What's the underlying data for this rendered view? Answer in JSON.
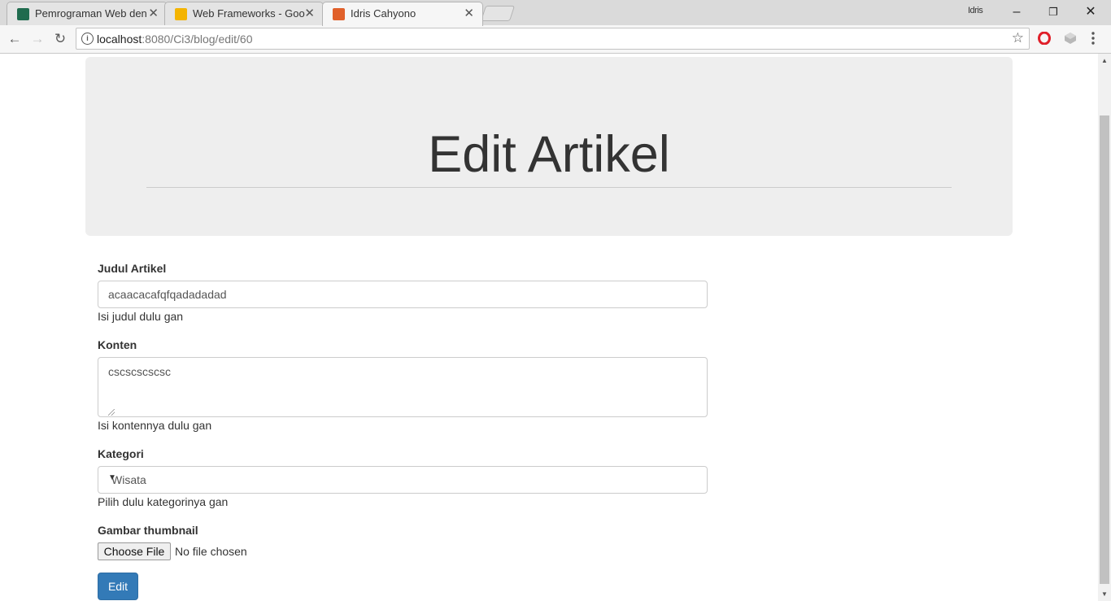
{
  "browser": {
    "tabs": [
      {
        "title": "Pemrograman Web deng",
        "favicon_color": "#1f6b4e",
        "close": "✕"
      },
      {
        "title": "Web Frameworks - Goog",
        "favicon_color": "#f4b400",
        "close": "✕"
      },
      {
        "title": "Idris Cahyono",
        "favicon_color": "#e0602a",
        "close": "✕"
      }
    ],
    "profile_name": "Idris",
    "window_controls": {
      "minimize": "–",
      "restore": "❐",
      "close": "✕"
    },
    "url_host": "localhost",
    "url_path": ":8080/Ci3/blog/edit/60",
    "nav": {
      "back": "←",
      "forward": "→",
      "reload": "↻"
    },
    "star": "☆"
  },
  "page": {
    "heading": "Edit Artikel",
    "form": {
      "title_label": "Judul Artikel",
      "title_value": "acaacacafqfqadadadad",
      "title_help": "Isi judul dulu gan",
      "content_label": "Konten",
      "content_value": "cscscscscsc",
      "content_help": "Isi kontennya dulu gan",
      "category_label": "Kategori",
      "category_value": "Wisata",
      "category_help": "Pilih dulu kategorinya gan",
      "thumbnail_label": "Gambar thumbnail",
      "file_button": "Choose File",
      "file_status": "No file chosen",
      "submit_label": "Edit"
    }
  },
  "colors": {
    "primary": "#337ab7",
    "jumbotron_bg": "#eeeeee"
  }
}
